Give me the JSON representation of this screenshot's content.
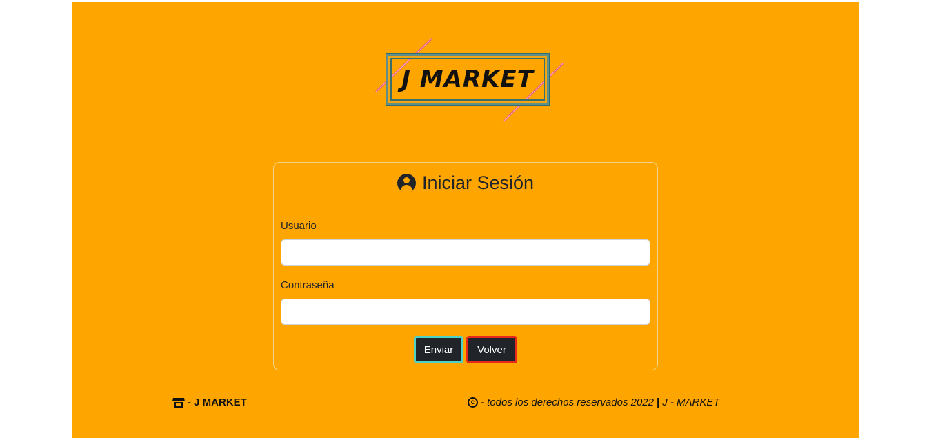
{
  "logo": {
    "text": "J MARKET",
    "line_color": "#e8527a",
    "icon": "j-market-logo"
  },
  "login": {
    "title": "Iniciar Sesión",
    "title_icon": "user-circle-icon",
    "username_label": "Usuario",
    "username_value": "",
    "password_label": "Contraseña",
    "password_value": "",
    "submit_label": "Enviar",
    "back_label": "Volver"
  },
  "footer": {
    "brand_icon": "store-icon",
    "brand_text": "- J MARKET",
    "copyright_icon": "copyright-icon",
    "copyright_text": "- todos los derechos reservados 2022",
    "separator": "|",
    "copyright_brand": "J - MARKET"
  },
  "colors": {
    "background": "#FFA500",
    "button": "#212529",
    "submit_border": "#4fd1c5",
    "back_border": "#e6291c"
  }
}
